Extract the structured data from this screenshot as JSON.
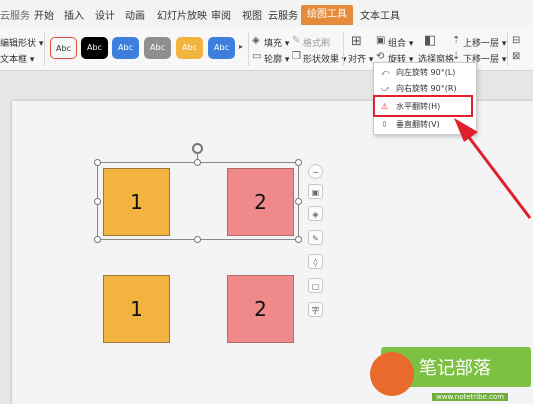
{
  "tabs": {
    "t0": "云服务",
    "t1": "开始",
    "t2": "插入",
    "t3": "设计",
    "t4": "动画",
    "t5": "幻灯片放映",
    "t6": "审阅",
    "t7": "视图",
    "t8": "云服务",
    "t9": "绘图工具",
    "t10": "文本工具"
  },
  "ribbon": {
    "left1": "编辑形状 ▾",
    "left2": "文本框 ▾",
    "fill": "填充 ▾",
    "format_painter": "格式刷",
    "outline": "轮廓 ▾",
    "shape_effect": "形状效果 ▾",
    "group": "组合 ▾",
    "rotate": "旋转 ▾",
    "select_pane": "选择窗格",
    "align": "对齐 ▾",
    "bring_forward": "上移一层 ▾",
    "send_backward": "下移一层 ▾",
    "swatch_label": "Abc"
  },
  "swatches": {
    "s0": "#ffffff",
    "s1": "#000000",
    "s2": "#3d7fde",
    "s3": "#8f8f8f",
    "s4": "#f3b43f",
    "s5": "#3d7fde"
  },
  "menu": {
    "item1": "向左旋转 90°(L)",
    "item2": "向右旋转 90°(R)",
    "item3": "水平翻转(H)",
    "item4": "垂直翻转(V)"
  },
  "shapes": {
    "a": "1",
    "b": "2",
    "c": "1",
    "d": "2"
  },
  "sidebar_labels": {
    "text": "字"
  },
  "watermark": {
    "title": "笔记部落",
    "url": "www.notetribe.com"
  },
  "colors": {
    "accent": "#e58b3a",
    "highlight": "#e0202a",
    "arrow": "#e0202a"
  }
}
